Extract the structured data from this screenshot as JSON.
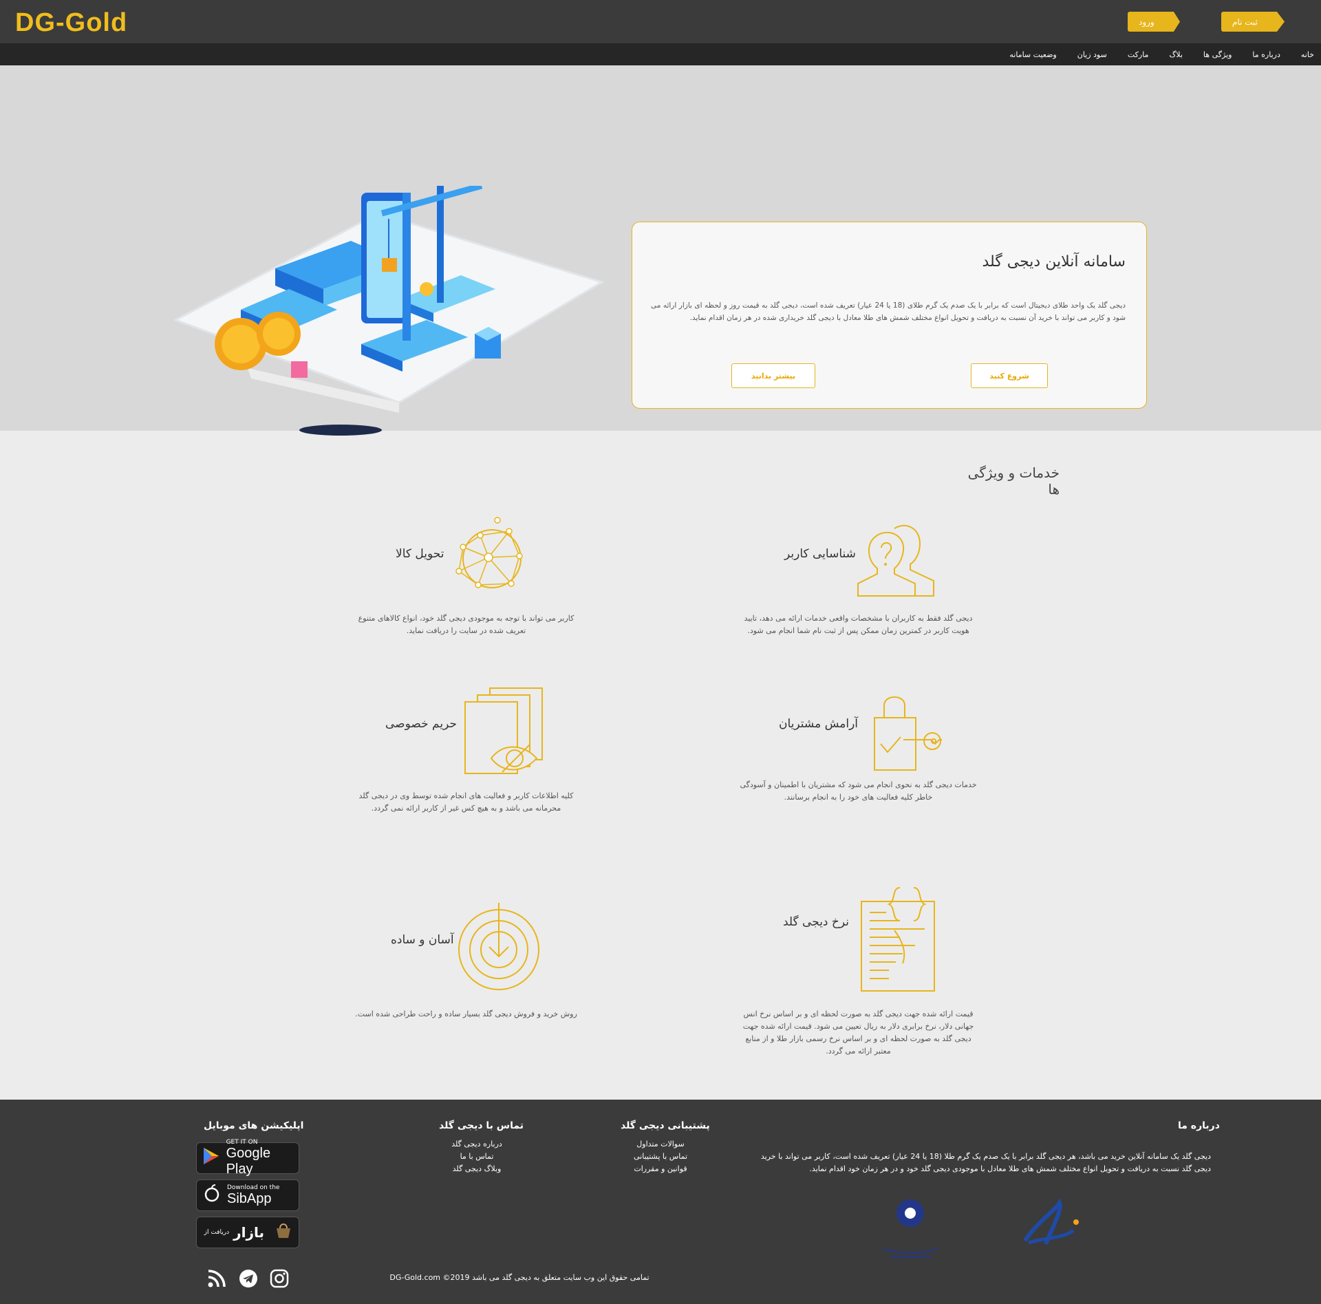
{
  "header": {
    "logo": "DG-Gold",
    "signup_label": "ثبت نام",
    "login_label": "ورود",
    "nav": [
      "خانه",
      "درباره ما",
      "ویژگی ها",
      "بلاگ",
      "مارکت",
      "سود زیان",
      "وضعیت سامانه"
    ]
  },
  "hero": {
    "title": "سامانه آنلاین دیجی گلد",
    "description": "دیجی گلد یک واحد طلای دیجیتال است که برابر با یک صدم یک گرم طلای (18 یا 24 عیار) تعریف شده است، دیجی گلد به قیمت روز و لحظه ای بازار ارائه می شود و کاربر می تواند با خرید آن نسبت به دریافت و تحویل انواع مختلف شمش های طلا معادل با دیجی گلد خریداری شده در هر زمان اقدام نماید.",
    "start_label": "شروع کنید",
    "more_label": "بیشتر بدانید"
  },
  "services": {
    "title": "خدمات و ویژگی ها",
    "items": [
      {
        "title": "شناسایی کاربر",
        "desc": "دیجی گلد فقط به کاربران با مشخصات واقعی خدمات ارائه می دهد، تایید هویت کاربر در کمترین زمان ممکن پس از ثبت نام شما انجام می شود.",
        "icon": "user-identity-icon"
      },
      {
        "title": "تحویل کالا",
        "desc": "کاربر می تواند با توجه به موجودی دیجی گلد خود، انواع کالاهای متنوع تعریف شده در سایت را دریافت نماید.",
        "icon": "network-globe-icon"
      },
      {
        "title": "آرامش مشتریان",
        "desc": "خدمات دیجی گلد به نحوی انجام می شود که مشتریان با اطمینان و آسودگی خاطر کلیه فعالیت های خود را به انجام برسانند.",
        "icon": "lock-key-icon"
      },
      {
        "title": "حریم خصوصی",
        "desc": "کلیه اطلاعات کاربر و فعالیت های انجام شده توسط وی در دیجی گلد محرمانه می باشد و به هیچ کس غیر از کاربر ارائه نمی گردد.",
        "icon": "hidden-eye-icon"
      },
      {
        "title": "نرخ دیجی گلد",
        "desc": "قیمت ارائه شده جهت دیجی گلد به صورت لحظه ای و بر اساس نرخ انس جهانی دلار، نرخ برابری دلار به ریال تعیین می شود. قیمت ارائه شده جهت دیجی گلد به صورت لحظه ای و بر اساس نرخ رسمی بازار طلا و از منابع معتبر ارائه می گردد.",
        "icon": "document-code-icon"
      },
      {
        "title": "آسان و ساده",
        "desc": "روش خرید و فروش دیجی گلد بسیار ساده و راحت طراحی شده است.",
        "icon": "target-download-icon"
      }
    ]
  },
  "footer": {
    "about_title": "درباره ما",
    "about_text": "دیجی گلد یک سامانه آنلاین خرید می باشد، هر دیجی گلد برابر با یک صدم یک گرم طلا (18 یا 24 عیار) تعریف شده است، کاربر می تواند با خرید دیجی گلد نسبت به دریافت و تحویل انواع مختلف شمش های طلا معادل با موجودی دیجی گلد خود و در هر زمان خود اقدام نماید.",
    "support_title": "پشتیبانی دیجی گلد",
    "support_links": [
      "سوالات متداول",
      "تماس با پشتیبانی",
      "قوانین و مقررات"
    ],
    "contact_title": "تماس با دیجی گلد",
    "contact_links": [
      "درباره دیجی گلد",
      "تماس با ما",
      "وبلاگ دیجی گلد"
    ],
    "apps_title": "اپلیکیشن های موبایل",
    "google_small": "GET IT ON",
    "google_big": "Google Play",
    "sibapp_small": "Download on the",
    "sibapp_big": "SibApp",
    "bazaar_small": "دریافت از",
    "bazaar_big": "بازار",
    "copyright": "تمامی حقوق این وب سایت متعلق به دیجی گلد می باشد DG-Gold.com ©2019"
  },
  "colors": {
    "accent": "#e7b51c",
    "header_bg": "#3b3b3b",
    "nav_bg": "#262626",
    "hero_bg": "#d8d8d8",
    "page_bg": "#ececec"
  }
}
